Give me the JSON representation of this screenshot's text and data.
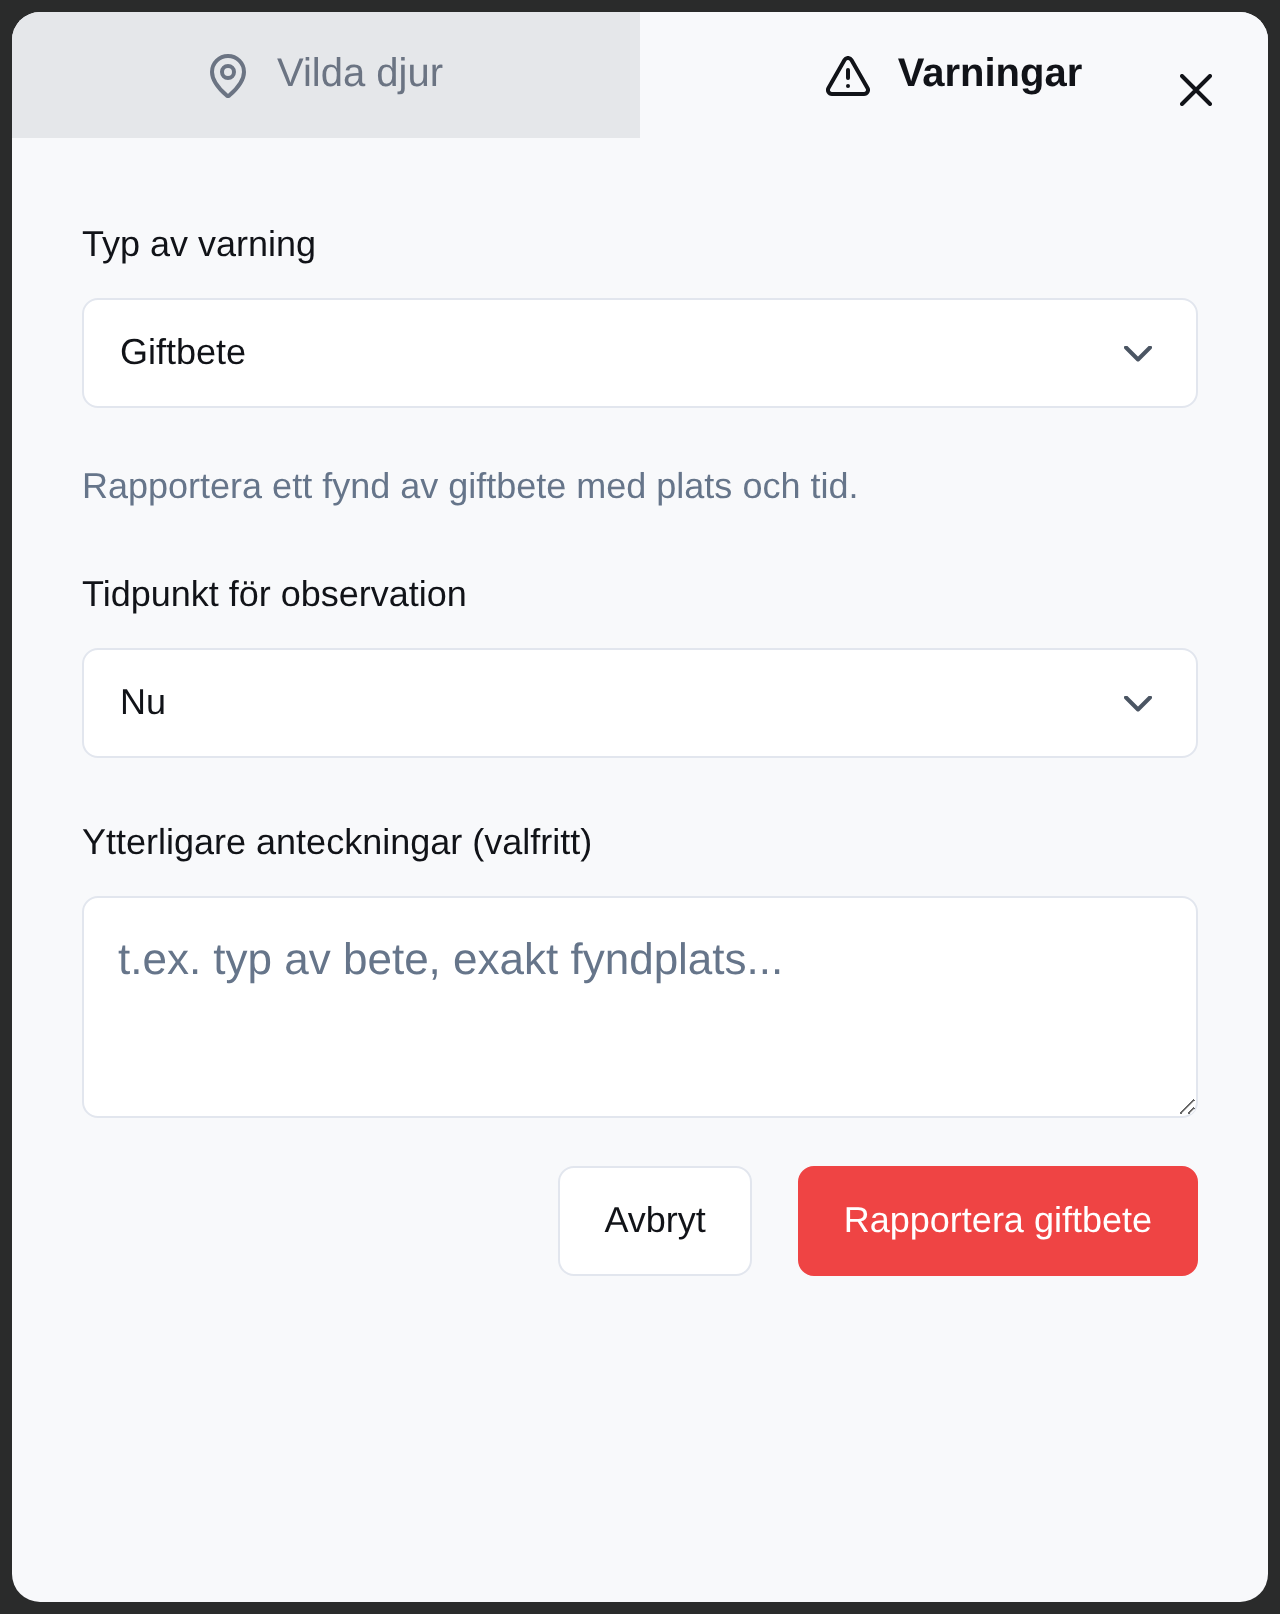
{
  "tabs": [
    {
      "label": "Vilda djur",
      "selected": false
    },
    {
      "label": "Varningar",
      "selected": true
    }
  ],
  "fields": [
    {
      "kind": "select",
      "label": "Typ av varning",
      "value": "Giftbete",
      "hint": "Rapportera ett fynd av giftbete med plats och tid."
    },
    {
      "kind": "select",
      "label": "Tidpunkt för observation",
      "value": "Nu"
    },
    {
      "kind": "textarea",
      "label": "Ytterligare anteckningar (valfritt)",
      "placeholder": "t.ex. typ av bete, exakt fyndplats..."
    }
  ],
  "buttons": [
    {
      "label": "Avbryt",
      "kind": "secondary"
    },
    {
      "label": "Rapportera giftbete",
      "kind": "primary"
    }
  ]
}
